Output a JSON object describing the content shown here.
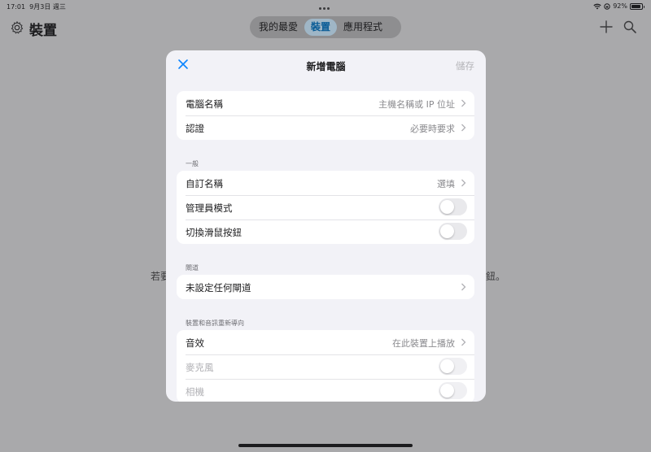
{
  "status_bar": {
    "time": "17:01",
    "date": "9月3日 週三",
    "battery_text": "92%",
    "battery_level": 0.92
  },
  "nav": {
    "title": "裝置",
    "tabs": [
      {
        "label": "我的最愛",
        "selected": false
      },
      {
        "label": "裝置",
        "selected": true
      },
      {
        "label": "應用程式",
        "selected": false
      }
    ]
  },
  "background": {
    "empty_text_left": "若要",
    "empty_text_right": "鈕。"
  },
  "modal": {
    "title": "新增電腦",
    "save_label": "儲存",
    "computer": {
      "name_label": "電腦名稱",
      "name_placeholder": "主機名稱或 IP 位址",
      "auth_label": "認證",
      "auth_value": "必要時要求"
    },
    "general": {
      "header": "一般",
      "custom_name_label": "自訂名稱",
      "custom_name_value": "選填",
      "admin_mode_label": "管理員模式",
      "admin_mode_on": false,
      "swap_mouse_label": "切換滑鼠按鈕",
      "swap_mouse_on": false
    },
    "gateway": {
      "header": "閘道",
      "label": "未設定任何閘道"
    },
    "redirection": {
      "header": "裝置和音訊重新導向",
      "sound_label": "音效",
      "sound_value": "在此裝置上播放",
      "microphone_label": "麥克風",
      "microphone_on": false,
      "camera_label": "相機",
      "camera_on": false
    }
  },
  "colors": {
    "accent": "#0a84ff",
    "dim_overlay": "#a9a9ab"
  }
}
